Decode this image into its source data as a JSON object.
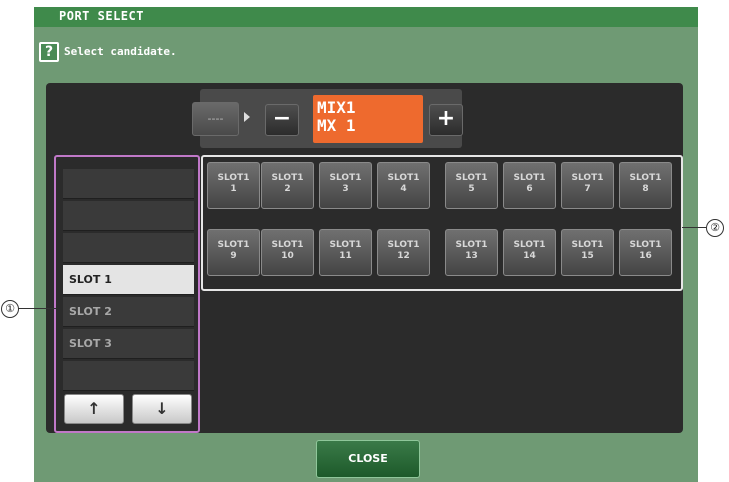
{
  "dialog": {
    "title": "PORT SELECT",
    "hint": "Select candidate.",
    "close_label": "CLOSE"
  },
  "header": {
    "dash_label": "----",
    "channel_line1": "MIX1",
    "channel_line2": "MX 1",
    "minus_label": "−",
    "plus_label": "+"
  },
  "slot_list": {
    "items": [
      "",
      "",
      "",
      "SLOT 1",
      "SLOT 2",
      "SLOT 3",
      ""
    ],
    "selected": "SLOT 1",
    "up_label": "↑",
    "down_label": "↓"
  },
  "slot_ports": [
    {
      "line1": "SLOT1",
      "line2": "1"
    },
    {
      "line1": "SLOT1",
      "line2": "2"
    },
    {
      "line1": "SLOT1",
      "line2": "3"
    },
    {
      "line1": "SLOT1",
      "line2": "4"
    },
    {
      "line1": "SLOT1",
      "line2": "5"
    },
    {
      "line1": "SLOT1",
      "line2": "6"
    },
    {
      "line1": "SLOT1",
      "line2": "7"
    },
    {
      "line1": "SLOT1",
      "line2": "8"
    },
    {
      "line1": "SLOT1",
      "line2": "9"
    },
    {
      "line1": "SLOT1",
      "line2": "10"
    },
    {
      "line1": "SLOT1",
      "line2": "11"
    },
    {
      "line1": "SLOT1",
      "line2": "12"
    },
    {
      "line1": "SLOT1",
      "line2": "13"
    },
    {
      "line1": "SLOT1",
      "line2": "14"
    },
    {
      "line1": "SLOT1",
      "line2": "15"
    },
    {
      "line1": "SLOT1",
      "line2": "16"
    }
  ],
  "callouts": {
    "one": "①",
    "two": "②"
  },
  "colors": {
    "dialog_bg": "#6f9a74",
    "title_bar": "#3f8a4b",
    "channel_display": "#ee6a2e",
    "list_border": "#c078c8"
  }
}
